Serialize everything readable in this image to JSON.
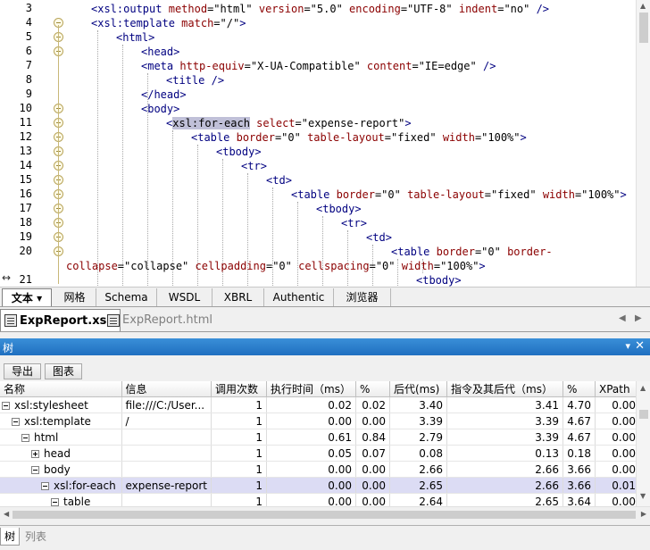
{
  "editor": {
    "lines": [
      {
        "n": "3",
        "indent": 0,
        "fold": false,
        "parts": [
          [
            "pt",
            "<"
          ],
          [
            "tn",
            "xsl:output"
          ],
          [
            "t",
            " "
          ],
          [
            "an",
            "method"
          ],
          [
            "av",
            "=\"html\" "
          ],
          [
            "an",
            "version"
          ],
          [
            "av",
            "=\"5.0\" "
          ],
          [
            "an",
            "encoding"
          ],
          [
            "av",
            "=\"UTF-8\" "
          ],
          [
            "an",
            "indent"
          ],
          [
            "av",
            "=\"no\" "
          ],
          [
            "pt",
            "/>"
          ]
        ]
      },
      {
        "n": "4",
        "indent": 0,
        "fold": true,
        "parts": [
          [
            "pt",
            "<"
          ],
          [
            "tn",
            "xsl:template"
          ],
          [
            "t",
            " "
          ],
          [
            "an",
            "match"
          ],
          [
            "av",
            "=\"/\""
          ],
          [
            "pt",
            ">"
          ]
        ]
      },
      {
        "n": "5",
        "indent": 1,
        "fold": true,
        "parts": [
          [
            "pt",
            "<"
          ],
          [
            "tn",
            "html"
          ],
          [
            "pt",
            ">"
          ]
        ]
      },
      {
        "n": "6",
        "indent": 2,
        "fold": true,
        "parts": [
          [
            "pt",
            "<"
          ],
          [
            "tn",
            "head"
          ],
          [
            "pt",
            ">"
          ]
        ]
      },
      {
        "n": "7",
        "indent": 2,
        "fold": false,
        "parts": [
          [
            "pt",
            "<"
          ],
          [
            "tn",
            "meta"
          ],
          [
            "t",
            " "
          ],
          [
            "an",
            "http-equiv"
          ],
          [
            "av",
            "=\"X-UA-Compatible\" "
          ],
          [
            "an",
            "content"
          ],
          [
            "av",
            "=\"IE=edge\" "
          ],
          [
            "pt",
            "/>"
          ]
        ]
      },
      {
        "n": "8",
        "indent": 3,
        "fold": false,
        "parts": [
          [
            "pt",
            "<"
          ],
          [
            "tn",
            "title"
          ],
          [
            "t",
            " "
          ],
          [
            "pt",
            "/>"
          ]
        ]
      },
      {
        "n": "9",
        "indent": 2,
        "fold": false,
        "parts": [
          [
            "pt",
            "</"
          ],
          [
            "tn",
            "head"
          ],
          [
            "pt",
            ">"
          ]
        ]
      },
      {
        "n": "10",
        "indent": 2,
        "fold": true,
        "parts": [
          [
            "pt",
            "<"
          ],
          [
            "tn",
            "body"
          ],
          [
            "pt",
            ">"
          ]
        ]
      },
      {
        "n": "11",
        "indent": 3,
        "fold": true,
        "parts": [
          [
            "pt",
            "<"
          ],
          [
            "hl",
            "xsl:for-each"
          ],
          [
            "t",
            " "
          ],
          [
            "an",
            "select"
          ],
          [
            "av",
            "=\"expense-report\""
          ],
          [
            "pt",
            ">"
          ]
        ]
      },
      {
        "n": "12",
        "indent": 4,
        "fold": true,
        "parts": [
          [
            "pt",
            "<"
          ],
          [
            "tn",
            "table"
          ],
          [
            "t",
            " "
          ],
          [
            "an",
            "border"
          ],
          [
            "av",
            "=\"0\" "
          ],
          [
            "an",
            "table-layout"
          ],
          [
            "av",
            "=\"fixed\" "
          ],
          [
            "an",
            "width"
          ],
          [
            "av",
            "=\"100%\""
          ],
          [
            "pt",
            ">"
          ]
        ]
      },
      {
        "n": "13",
        "indent": 5,
        "fold": true,
        "parts": [
          [
            "pt",
            "<"
          ],
          [
            "tn",
            "tbody"
          ],
          [
            "pt",
            ">"
          ]
        ]
      },
      {
        "n": "14",
        "indent": 6,
        "fold": true,
        "parts": [
          [
            "pt",
            "<"
          ],
          [
            "tn",
            "tr"
          ],
          [
            "pt",
            ">"
          ]
        ]
      },
      {
        "n": "15",
        "indent": 7,
        "fold": true,
        "parts": [
          [
            "pt",
            "<"
          ],
          [
            "tn",
            "td"
          ],
          [
            "pt",
            ">"
          ]
        ]
      },
      {
        "n": "16",
        "indent": 8,
        "fold": true,
        "parts": [
          [
            "pt",
            "<"
          ],
          [
            "tn",
            "table"
          ],
          [
            "t",
            " "
          ],
          [
            "an",
            "border"
          ],
          [
            "av",
            "=\"0\" "
          ],
          [
            "an",
            "table-layout"
          ],
          [
            "av",
            "=\"fixed\" "
          ],
          [
            "an",
            "width"
          ],
          [
            "av",
            "=\"100%\""
          ],
          [
            "pt",
            ">"
          ]
        ]
      },
      {
        "n": "17",
        "indent": 9,
        "fold": true,
        "parts": [
          [
            "pt",
            "<"
          ],
          [
            "tn",
            "tbody"
          ],
          [
            "pt",
            ">"
          ]
        ]
      },
      {
        "n": "18",
        "indent": 10,
        "fold": true,
        "parts": [
          [
            "pt",
            "<"
          ],
          [
            "tn",
            "tr"
          ],
          [
            "pt",
            ">"
          ]
        ]
      },
      {
        "n": "19",
        "indent": 11,
        "fold": true,
        "parts": [
          [
            "pt",
            "<"
          ],
          [
            "tn",
            "td"
          ],
          [
            "pt",
            ">"
          ]
        ]
      },
      {
        "n": "20",
        "indent": 12,
        "fold": true,
        "parts": [
          [
            "pt",
            "<"
          ],
          [
            "tn",
            "table"
          ],
          [
            "t",
            " "
          ],
          [
            "an",
            "border"
          ],
          [
            "av",
            "=\"0\" "
          ],
          [
            "an",
            "border-"
          ]
        ]
      },
      {
        "n": "",
        "indent": -1,
        "fold": false,
        "parts": [
          [
            "an",
            "collapse"
          ],
          [
            "av",
            "=\"collapse\" "
          ],
          [
            "an",
            "cellpadding"
          ],
          [
            "av",
            "=\"0\" "
          ],
          [
            "an",
            "cellspacing"
          ],
          [
            "av",
            "=\"0\" "
          ],
          [
            "an",
            "width"
          ],
          [
            "av",
            "=\"100%\""
          ],
          [
            "pt",
            ">"
          ]
        ]
      },
      {
        "n": "21",
        "indent": 13,
        "fold": false,
        "parts": [
          [
            "pt",
            "<"
          ],
          [
            "tn",
            "tbody"
          ],
          [
            "pt",
            ">"
          ]
        ]
      }
    ]
  },
  "view_tabs": [
    "文本",
    "网格",
    "Schema",
    "WSDL",
    "XBRL",
    "Authentic",
    "浏览器"
  ],
  "view_tab_dropdown": "▾",
  "file_tabs": [
    {
      "label": "ExpReport.xslt",
      "active": true
    },
    {
      "label": "ExpReport.html",
      "active": false
    }
  ],
  "panel": {
    "title": "树",
    "pin_symbol": "▾",
    "close_symbol": "✕",
    "toolbar": {
      "export_label": "导出",
      "chart_label": "图表"
    }
  },
  "table": {
    "columns": [
      "名称",
      "信息",
      "调用次数",
      "执行时间（ms）",
      "%",
      "后代(ms)",
      "指令及其后代（ms）",
      "%",
      "XPath"
    ],
    "rows": [
      {
        "level": 0,
        "expander": "minus",
        "name": "xsl:stylesheet",
        "info": "file:///C:/User...",
        "calls": "1",
        "exec": "0.02",
        "pct": "0.02",
        "desc": "3.40",
        "instr": "3.41",
        "pct2": "4.70",
        "xpath": "0.00",
        "selected": false
      },
      {
        "level": 1,
        "expander": "minus",
        "name": "xsl:template",
        "info": "/",
        "calls": "1",
        "exec": "0.00",
        "pct": "0.00",
        "desc": "3.39",
        "instr": "3.39",
        "pct2": "4.67",
        "xpath": "0.00",
        "selected": false
      },
      {
        "level": 2,
        "expander": "minus",
        "name": "html",
        "info": "",
        "calls": "1",
        "exec": "0.61",
        "pct": "0.84",
        "desc": "2.79",
        "instr": "3.39",
        "pct2": "4.67",
        "xpath": "0.00",
        "selected": false
      },
      {
        "level": 3,
        "expander": "plus",
        "name": "head",
        "info": "",
        "calls": "1",
        "exec": "0.05",
        "pct": "0.07",
        "desc": "0.08",
        "instr": "0.13",
        "pct2": "0.18",
        "xpath": "0.00",
        "selected": false
      },
      {
        "level": 3,
        "expander": "minus",
        "name": "body",
        "info": "",
        "calls": "1",
        "exec": "0.00",
        "pct": "0.00",
        "desc": "2.66",
        "instr": "2.66",
        "pct2": "3.66",
        "xpath": "0.00",
        "selected": false
      },
      {
        "level": 4,
        "expander": "minus",
        "name": "xsl:for-each",
        "info": "expense-report",
        "calls": "1",
        "exec": "0.00",
        "pct": "0.00",
        "desc": "2.65",
        "instr": "2.66",
        "pct2": "3.66",
        "xpath": "0.01",
        "selected": true
      },
      {
        "level": 5,
        "expander": "minus",
        "name": "table",
        "info": "",
        "calls": "1",
        "exec": "0.00",
        "pct": "0.00",
        "desc": "2.64",
        "instr": "2.65",
        "pct2": "3.64",
        "xpath": "0.00",
        "selected": false
      }
    ]
  },
  "bottom_tabs": [
    {
      "label": "树",
      "active": true
    },
    {
      "label": "列表",
      "active": false
    }
  ],
  "colors": {
    "panel_header": "#1f6fc0",
    "selected_row": "#dcdcf4",
    "tag_name": "#000080",
    "attr_name": "#8b0000"
  }
}
